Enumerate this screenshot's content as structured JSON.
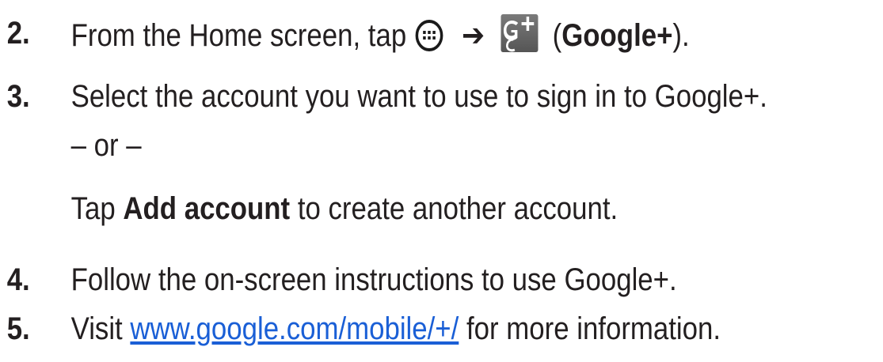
{
  "steps": [
    {
      "number": "2.",
      "prefix": "From the Home screen, tap",
      "arrow": "➔",
      "app_open": "(",
      "app_name": "Google+",
      "app_close": ")."
    },
    {
      "number": "3.",
      "text": "Select the account you want to use to sign in to Google+.",
      "or": "– or –",
      "alt_prefix": "Tap",
      "alt_bold": "Add account",
      "alt_suffix": "to create another account."
    },
    {
      "number": "4.",
      "text": "Follow the on-screen instructions to use Google+."
    },
    {
      "number": "5.",
      "prefix": "Visit",
      "link": "www.google.com/mobile/+/",
      "suffix": "for more information."
    }
  ],
  "icons": {
    "apps": "apps-icon",
    "google_plus": "google-plus-icon"
  },
  "colors": {
    "text": "#231f20",
    "link": "#1a5fd6"
  }
}
